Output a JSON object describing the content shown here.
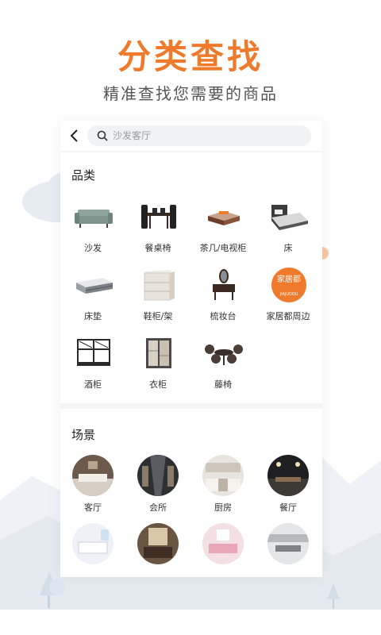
{
  "hero": {
    "title": "分类查找",
    "subtitle": "精准查找您需要的商品"
  },
  "search": {
    "placeholder": "沙发客厅"
  },
  "categories": {
    "title": "品类",
    "items": [
      {
        "label": "沙发",
        "icon": "sofa-icon"
      },
      {
        "label": "餐桌椅",
        "icon": "dining-table-icon"
      },
      {
        "label": "茶几/电视柜",
        "icon": "tea-table-icon"
      },
      {
        "label": "床",
        "icon": "bed-icon"
      },
      {
        "label": "床垫",
        "icon": "mattress-icon"
      },
      {
        "label": "鞋柜/架",
        "icon": "shoe-cabinet-icon"
      },
      {
        "label": "梳妆台",
        "icon": "dresser-icon"
      },
      {
        "label": "家居都周边",
        "icon": "jiajudou-logo-icon",
        "logo_text": "家居都",
        "logo_sub": "JIAJUDOU"
      },
      {
        "label": "酒柜",
        "icon": "wine-cabinet-icon"
      },
      {
        "label": "衣柜",
        "icon": "wardrobe-icon"
      },
      {
        "label": "藤椅",
        "icon": "rattan-chair-icon"
      }
    ]
  },
  "scenes": {
    "title": "场景",
    "items": [
      {
        "label": "客厅"
      },
      {
        "label": "会所"
      },
      {
        "label": "厨房"
      },
      {
        "label": "餐厅"
      },
      {
        "label": ""
      },
      {
        "label": ""
      },
      {
        "label": ""
      },
      {
        "label": ""
      }
    ]
  },
  "colors": {
    "accent": "#f07a2c",
    "background": "#f4f5f7",
    "text": "#333333"
  }
}
